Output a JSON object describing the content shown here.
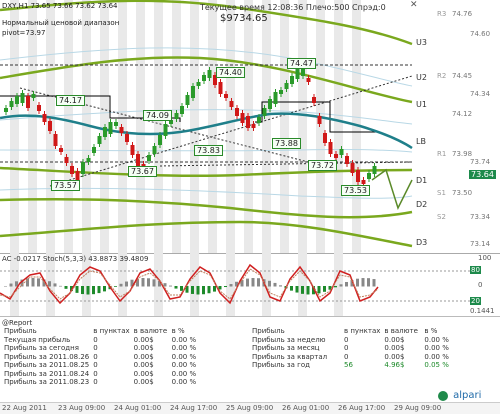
{
  "header": {
    "symbol": "DXY,H1",
    "ohlc": "73.65 73.66 73.62 73.64",
    "server_time": "Текущее время 12:08:36 Плечо:500 Спрэд:0",
    "balance": "$9734.65",
    "channel": "Нормальный ценовой диапазон",
    "pivot": "pivot=73.97"
  },
  "levels": {
    "u3": "U3",
    "u2": "U2",
    "u1": "U1",
    "lb": "LB",
    "d1": "D1",
    "d2": "D2",
    "d3": "D3",
    "r3": "R3",
    "r2": "R2",
    "r1": "R1",
    "s1": "S1",
    "s2": "S2"
  },
  "price_scale": [
    "74.76",
    "74.60",
    "74.45",
    "74.34",
    "74.12",
    "73.98",
    "73.74",
    "73.64",
    "73.50",
    "73.34",
    "73.14"
  ],
  "current_price": "73.64",
  "chart_labels": [
    "74.17",
    "74.09",
    "74.40",
    "74.47",
    "73.57",
    "73.67",
    "73.83",
    "73.88",
    "73.72",
    "73.53"
  ],
  "indicator": {
    "title": "AC -0.0217 Stoch(5,3,3) 43.8873 39.4809",
    "scale": [
      "100",
      "80",
      "20",
      "0",
      "0.1441"
    ]
  },
  "report": {
    "title": "@Report",
    "headers": [
      "Прибыль",
      "в пунктах",
      "в валюте",
      "в %"
    ],
    "left_rows": [
      [
        "Текущая прибыль",
        "0",
        "0.00$",
        "0.00 %"
      ],
      [
        "Прибыль за сегодня",
        "0",
        "0.00$",
        "0.00 %"
      ],
      [
        "Прибыль за 2011.08.26",
        "0",
        "0.00$",
        "0.00 %"
      ],
      [
        "Прибыль за 2011.08.25",
        "0",
        "0.00$",
        "0.00 %"
      ],
      [
        "Прибыль за 2011.08.24",
        "0",
        "0.00$",
        "0.00 %"
      ],
      [
        "Прибыль за 2011.08.23",
        "0",
        "0.00$",
        "0.00 %"
      ]
    ],
    "right_rows": [
      [
        "Прибыль за неделю",
        "0",
        "0.00$",
        "0.00 %"
      ],
      [
        "Прибыль за месяц",
        "0",
        "0.00$",
        "0.00 %"
      ],
      [
        "Прибыль за квартал",
        "0",
        "0.00$",
        "0.00 %"
      ],
      [
        "Прибыль за год",
        "56",
        "4.96$",
        "0.05 %"
      ]
    ],
    "brand": "alpari"
  },
  "time_axis": [
    "22 Aug 2011",
    "23 Aug 09:00",
    "24 Aug 01:00",
    "24 Aug 17:00",
    "25 Aug 09:00",
    "26 Aug 01:00",
    "26 Aug 17:00",
    "29 Aug 09:00"
  ],
  "colors": {
    "up": "#2a9a2a",
    "down": "#d01818",
    "channel": "#7aa81e",
    "ma": "#1f7f8a",
    "stoch": "#d02020"
  }
}
